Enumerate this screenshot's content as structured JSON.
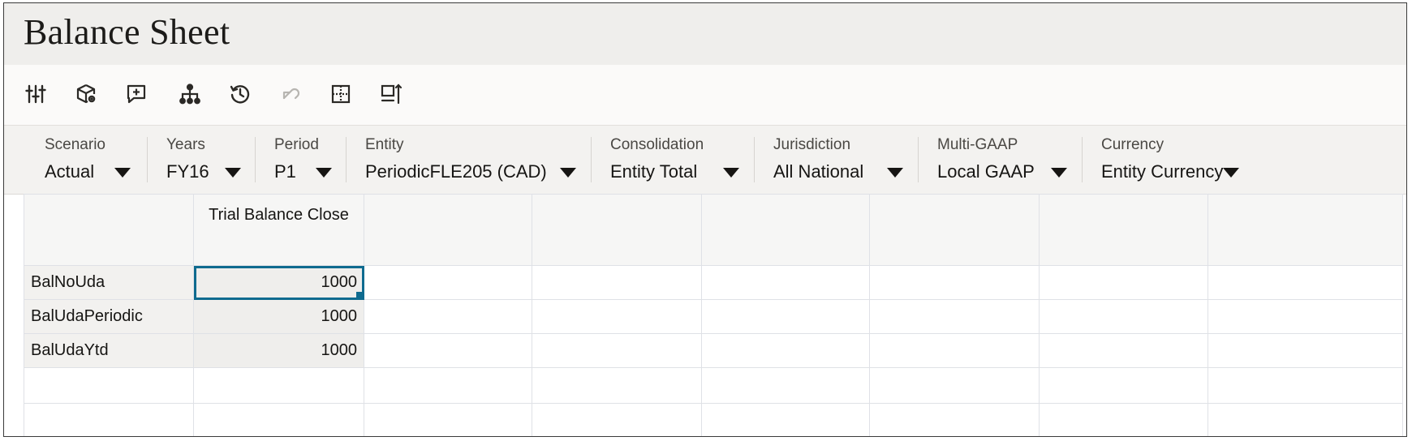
{
  "title": "Balance Sheet",
  "toolbar": {
    "icons": [
      "sliders-icon",
      "cube-gear-icon",
      "add-comment-icon",
      "hierarchy-icon",
      "history-icon",
      "undo-icon",
      "grid-icon",
      "column-layout-icon"
    ]
  },
  "pov": [
    {
      "label": "Scenario",
      "value": "Actual"
    },
    {
      "label": "Years",
      "value": "FY16"
    },
    {
      "label": "Period",
      "value": "P1"
    },
    {
      "label": "Entity",
      "value": "PeriodicFLE205 (CAD)"
    },
    {
      "label": "Consolidation",
      "value": "Entity Total"
    },
    {
      "label": "Jurisdiction",
      "value": "All National"
    },
    {
      "label": "Multi-GAAP",
      "value": "Local GAAP"
    },
    {
      "label": "Currency",
      "value": "Entity Currency"
    }
  ],
  "grid": {
    "column_header": "Trial Balance Close",
    "rows": [
      {
        "label": "BalNoUda",
        "value": "1000"
      },
      {
        "label": "BalUdaPeriodic",
        "value": "1000"
      },
      {
        "label": "BalUdaYtd",
        "value": "1000"
      }
    ]
  },
  "colors": {
    "selection": "#0f6b8f",
    "title_bar": "#efeeec",
    "pov_bar": "#f3f2f0"
  }
}
